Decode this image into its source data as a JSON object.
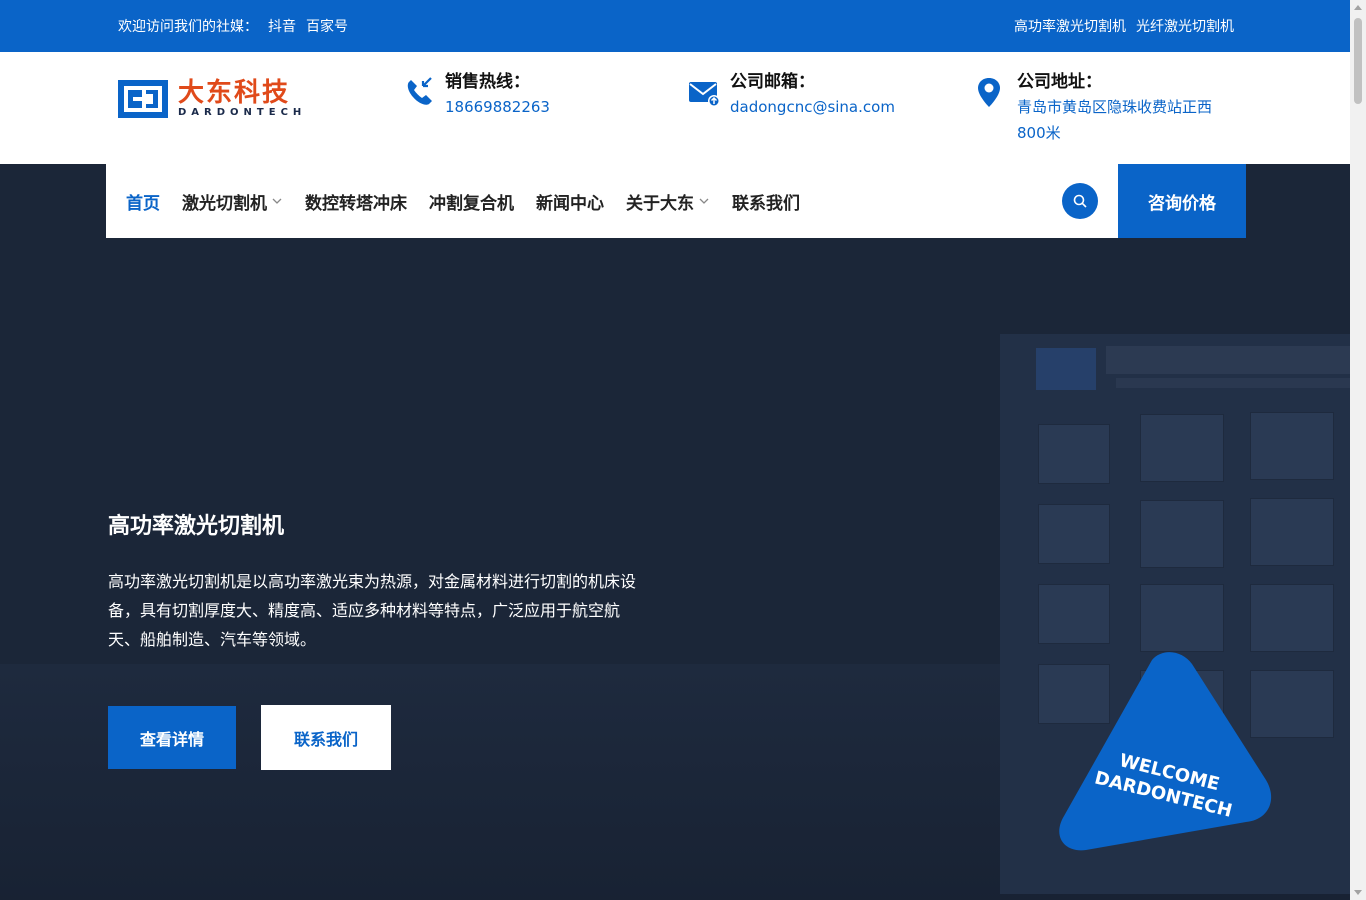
{
  "topbar": {
    "welcome": "欢迎访问我们的社媒：",
    "links": [
      "抖音",
      "百家号"
    ],
    "right_links": [
      "高功率激光切割机",
      "光纤激光切割机"
    ]
  },
  "logo": {
    "cn": "大东科技",
    "en": "DARDONTECH"
  },
  "contact": {
    "phone_title": "销售热线：",
    "phone_value": "18669882263",
    "email_title": "公司邮箱：",
    "email_value": "dadongcnc@sina.com",
    "address_title": "公司地址：",
    "address_value": "青岛市黄岛区隐珠收费站正西800米"
  },
  "nav": {
    "items": [
      "首页",
      "激光切割机",
      "数控转塔冲床",
      "冲割复合机",
      "新闻中心",
      "关于大东",
      "联系我们"
    ],
    "cta": "咨询价格"
  },
  "hero": {
    "title": "高功率激光切割机",
    "description": "高功率激光切割机是以高功率激光束为热源，对金属材料进行切割的机床设备，具有切割厚度大、精度高、适应多种材料等特点，广泛应用于航空航天、船舶制造、汽车等领域。",
    "btn_details": "查看详情",
    "btn_contact": "联系我们"
  },
  "badge": {
    "line1": "WELCOME",
    "line2": "DARDONTECH"
  },
  "colors": {
    "primary": "#0a64c8",
    "logo_orange": "#e04a1a",
    "hero_bg": "#1b2638"
  }
}
